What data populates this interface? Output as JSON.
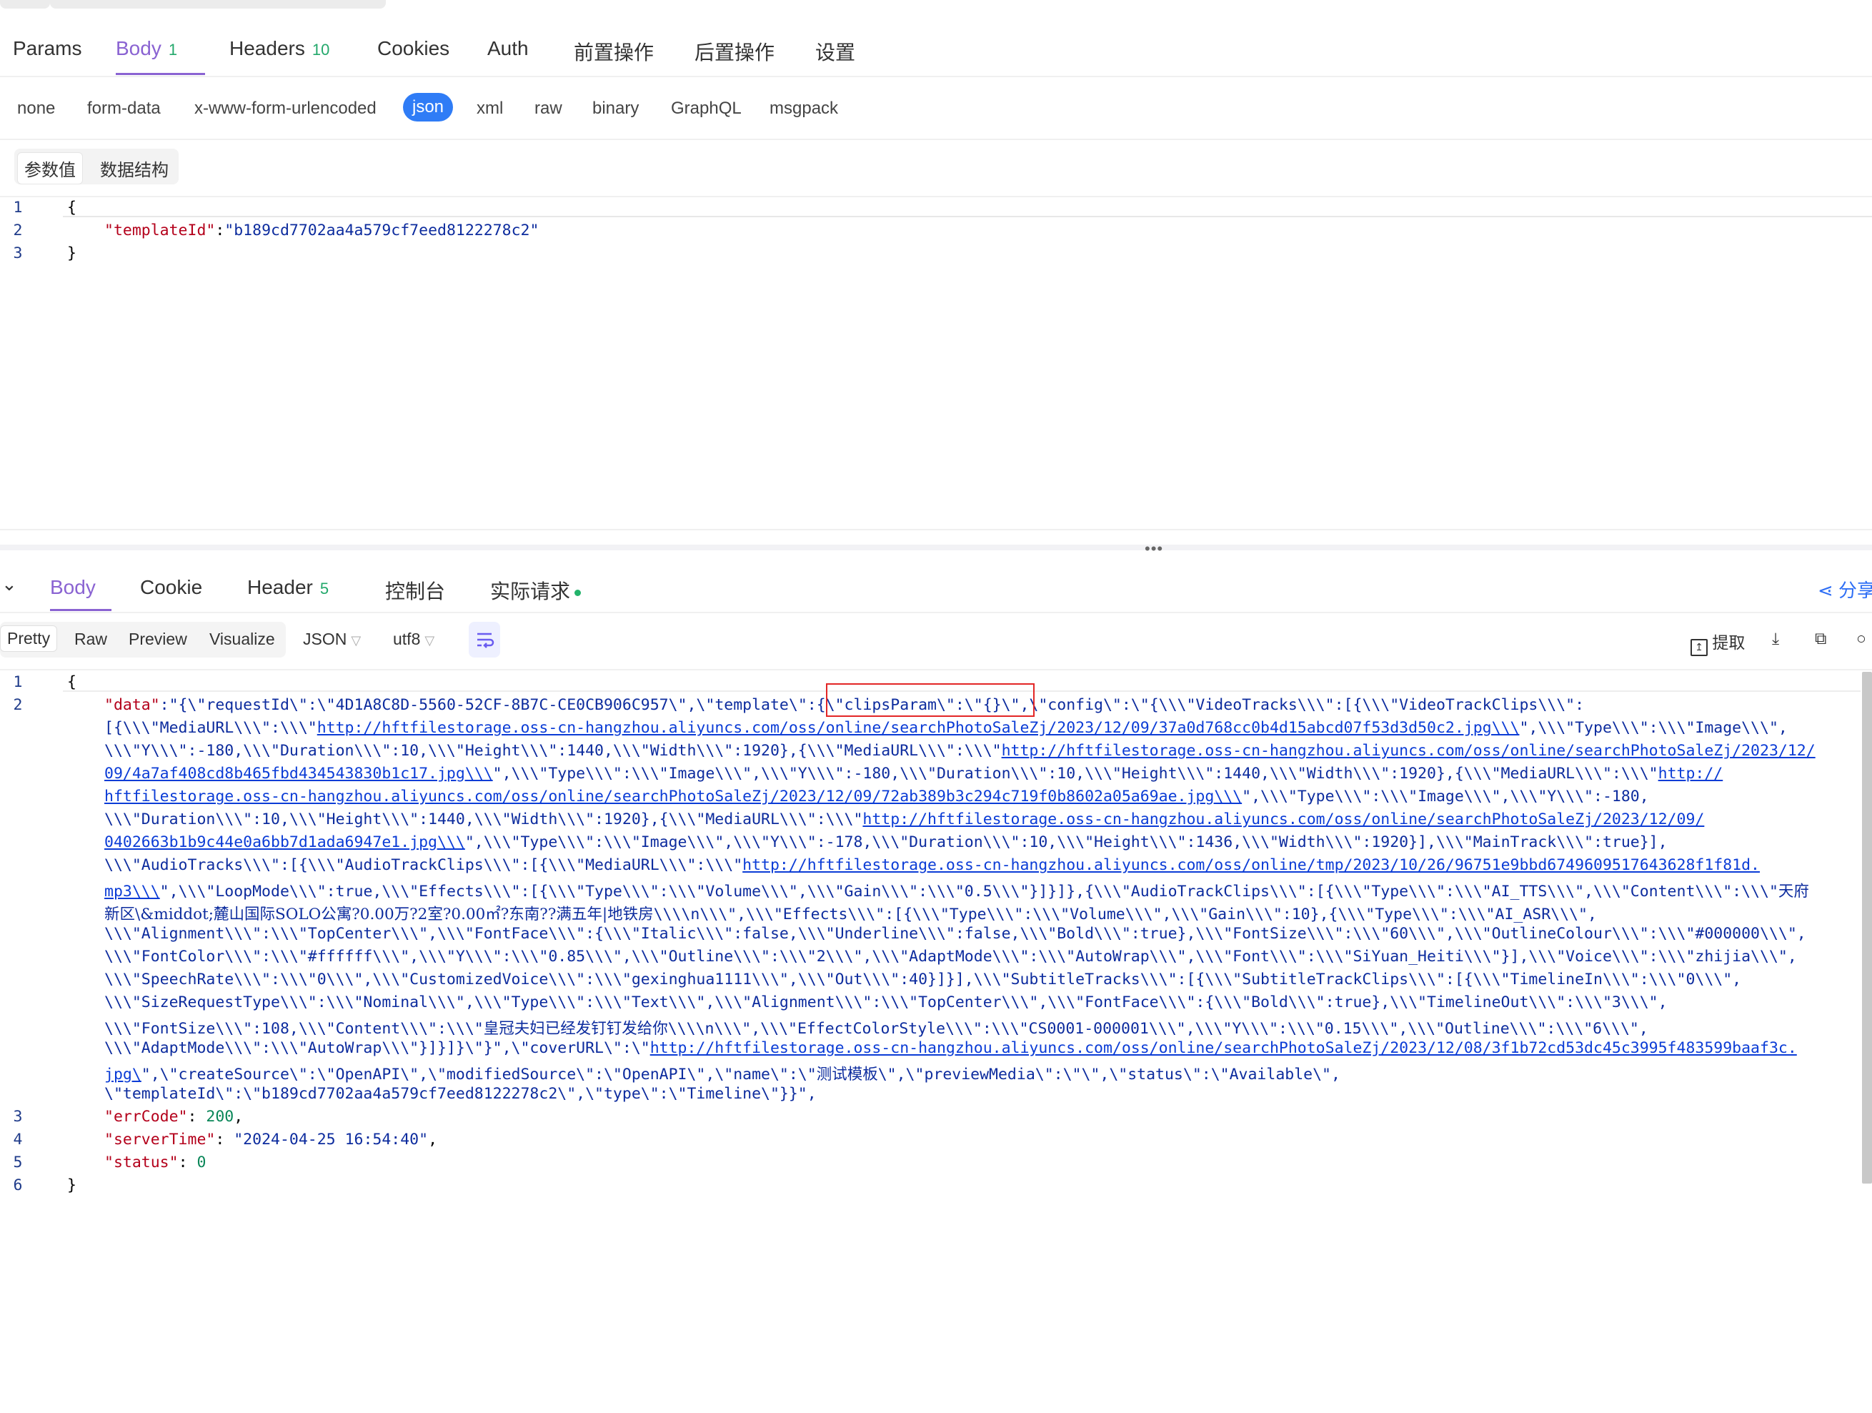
{
  "request": {
    "tabs": [
      {
        "label": "Params",
        "count": ""
      },
      {
        "label": "Body",
        "count": "1"
      },
      {
        "label": "Headers",
        "count": "10"
      },
      {
        "label": "Cookies",
        "count": ""
      },
      {
        "label": "Auth",
        "count": ""
      },
      {
        "label": "前置操作",
        "count": ""
      },
      {
        "label": "后置操作",
        "count": ""
      },
      {
        "label": "设置",
        "count": ""
      }
    ],
    "active_tab": "Body",
    "body_types": [
      "none",
      "form-data",
      "x-www-form-urlencoded",
      "json",
      "xml",
      "raw",
      "binary",
      "GraphQL",
      "msgpack"
    ],
    "active_body_type": "json",
    "segments": [
      "参数值",
      "数据结构"
    ],
    "line_numbers": [
      "1",
      "2",
      "3"
    ],
    "code": {
      "l1": "{",
      "l2_key": "\"templateId\"",
      "l2_colon": ":",
      "l2_val": "\"b189cd7702aa4a579cf7eed8122278c2\"",
      "l3": "}"
    }
  },
  "response": {
    "tabs": [
      {
        "label": "Body",
        "count": ""
      },
      {
        "label": "Cookie",
        "count": ""
      },
      {
        "label": "Header",
        "count": "5"
      },
      {
        "label": "控制台",
        "count": ""
      },
      {
        "label": "实际请求",
        "count": ""
      }
    ],
    "share_label": "分享",
    "view_modes": [
      "Pretty",
      "Raw",
      "Preview",
      "Visualize"
    ],
    "format": "JSON",
    "encoding": "utf8",
    "extract_label": "提取",
    "line_numbers": [
      "1",
      "2",
      "",
      "",
      "",
      "",
      "",
      "",
      "",
      "",
      "",
      "",
      "",
      "",
      "",
      "",
      "",
      "",
      "3",
      "4",
      "5",
      "6"
    ],
    "body": {
      "r1": "{",
      "r2a_key": "\"data\"",
      "r2a_1": ":\"{\\\"requestId\\\":\\\"4D1A8C8D-5560-52CF-8B7C-CE0CB906C957\\\",\\\"template\\\":",
      "r2a_hl": "{\\\"clipsParam\\\":\\\"{}\\",
      "r2a_2": "\",\\\"config\\\":\\\"{\\\\\\\"VideoTracks\\\\\\\":[{\\\\\\\"VideoTrackClips\\\\\\\":",
      "r2b_1": "[{\\\\\\\"MediaURL\\\\\\\":\\\\\\\"",
      "r2b_url": "http://hftfilestorage.oss-cn-hangzhou.aliyuncs.com/oss/online/searchPhotoSaleZj/2023/12/09/37a0d768cc0b4d15abcd07f53d3d50c2.jpg\\\\\\",
      "r2b_2": "\",\\\\\\\"Type\\\\\\\":\\\\\\\"Image\\\\\\\",",
      "r2c_1": "\\\\\\\"Y\\\\\\\":-180,\\\\\\\"Duration\\\\\\\":10,\\\\\\\"Height\\\\\\\":1440,\\\\\\\"Width\\\\\\\":1920},{\\\\\\\"MediaURL\\\\\\\":\\\\\\\"",
      "r2c_url": "http://hftfilestorage.oss-cn-hangzhou.aliyuncs.com/oss/online/searchPhotoSaleZj/2023/12/",
      "r2d_url": "09/4a7af408cd8b465fbd434543830b1c17.jpg\\\\\\",
      "r2d_2": "\",\\\\\\\"Type\\\\\\\":\\\\\\\"Image\\\\\\\",\\\\\\\"Y\\\\\\\":-180,\\\\\\\"Duration\\\\\\\":10,\\\\\\\"Height\\\\\\\":1440,\\\\\\\"Width\\\\\\\":1920},{\\\\\\\"MediaURL\\\\\\\":\\\\\\\"",
      "r2d_url2": "http://",
      "r2e_url": "hftfilestorage.oss-cn-hangzhou.aliyuncs.com/oss/online/searchPhotoSaleZj/2023/12/09/72ab389b3c294c719f0b8602a05a69ae.jpg\\\\\\",
      "r2e_2": "\",\\\\\\\"Type\\\\\\\":\\\\\\\"Image\\\\\\\",\\\\\\\"Y\\\\\\\":-180,",
      "r2f_1": "\\\\\\\"Duration\\\\\\\":10,\\\\\\\"Height\\\\\\\":1440,\\\\\\\"Width\\\\\\\":1920},{\\\\\\\"MediaURL\\\\\\\":\\\\\\\"",
      "r2f_url": "http://hftfilestorage.oss-cn-hangzhou.aliyuncs.com/oss/online/searchPhotoSaleZj/2023/12/09/",
      "r2g_url": "0402663b1b9c44e0a6bb7d1ada6947e1.jpg\\\\\\",
      "r2g_2": "\",\\\\\\\"Type\\\\\\\":\\\\\\\"Image\\\\\\\",\\\\\\\"Y\\\\\\\":-178,\\\\\\\"Duration\\\\\\\":10,\\\\\\\"Height\\\\\\\":1436,\\\\\\\"Width\\\\\\\":1920}],\\\\\\\"MainTrack\\\\\\\":true}],",
      "r2h_1": "\\\\\\\"AudioTracks\\\\\\\":[{\\\\\\\"AudioTrackClips\\\\\\\":[{\\\\\\\"MediaURL\\\\\\\":\\\\\\\"",
      "r2h_url": "http://hftfilestorage.oss-cn-hangzhou.aliyuncs.com/oss/online/tmp/2023/10/26/96751e9bbd6749609517643628f1f81d.",
      "r2i_url": "mp3\\\\\\",
      "r2i_2": "\",\\\\\\\"LoopMode\\\\\\\":true,\\\\\\\"Effects\\\\\\\":[{\\\\\\\"Type\\\\\\\":\\\\\\\"Volume\\\\\\\",\\\\\\\"Gain\\\\\\\":\\\\\\\"0.5\\\\\\\"}]}]},{\\\\\\\"AudioTrackClips\\\\\\\":[{\\\\\\\"Type\\\\\\\":\\\\\\\"AI_TTS\\\\\\\",\\\\\\\"Content\\\\\\\":\\\\\\\"",
      "r2i_cjk": "天府",
      "r2j_cjk": "新区\\&middot;麓山国际SOLO公寓?0.00万?2室?0.00㎡?东南??满五年|地铁房",
      "r2j_2": "\\\\\\\\n\\\\\\\",\\\\\\\"Effects\\\\\\\":[{\\\\\\\"Type\\\\\\\":\\\\\\\"Volume\\\\\\\",\\\\\\\"Gain\\\\\\\":10},{\\\\\\\"Type\\\\\\\":\\\\\\\"AI_ASR\\\\\\\",",
      "r2k": "\\\\\\\"Alignment\\\\\\\":\\\\\\\"TopCenter\\\\\\\",\\\\\\\"FontFace\\\\\\\":{\\\\\\\"Italic\\\\\\\":false,\\\\\\\"Underline\\\\\\\":false,\\\\\\\"Bold\\\\\\\":true},\\\\\\\"FontSize\\\\\\\":\\\\\\\"60\\\\\\\",\\\\\\\"OutlineColour\\\\\\\":\\\\\\\"#000000\\\\\\\",",
      "r2l": "\\\\\\\"FontColor\\\\\\\":\\\\\\\"#ffffff\\\\\\\",\\\\\\\"Y\\\\\\\":\\\\\\\"0.85\\\\\\\",\\\\\\\"Outline\\\\\\\":\\\\\\\"2\\\\\\\",\\\\\\\"AdaptMode\\\\\\\":\\\\\\\"AutoWrap\\\\\\\",\\\\\\\"Font\\\\\\\":\\\\\\\"SiYuan_Heiti\\\\\\\"}],\\\\\\\"Voice\\\\\\\":\\\\\\\"zhijia\\\\\\\",",
      "r2m": "\\\\\\\"SpeechRate\\\\\\\":\\\\\\\"0\\\\\\\",\\\\\\\"CustomizedVoice\\\\\\\":\\\\\\\"gexinghua1111\\\\\\\",\\\\\\\"Out\\\\\\\":40}]}],\\\\\\\"SubtitleTracks\\\\\\\":[{\\\\\\\"SubtitleTrackClips\\\\\\\":[{\\\\\\\"TimelineIn\\\\\\\":\\\\\\\"0\\\\\\\",",
      "r2n": "\\\\\\\"SizeRequestType\\\\\\\":\\\\\\\"Nominal\\\\\\\",\\\\\\\"Type\\\\\\\":\\\\\\\"Text\\\\\\\",\\\\\\\"Alignment\\\\\\\":\\\\\\\"TopCenter\\\\\\\",\\\\\\\"FontFace\\\\\\\":{\\\\\\\"Bold\\\\\\\":true},\\\\\\\"TimelineOut\\\\\\\":\\\\\\\"3\\\\\\\",",
      "r2o_1": "\\\\\\\"FontSize\\\\\\\":108,\\\\\\\"Content\\\\\\\":\\\\\\\"",
      "r2o_cjk": "皇冠夫妇已经发钉钉发给你",
      "r2o_2": "\\\\\\\\n\\\\\\\",\\\\\\\"EffectColorStyle\\\\\\\":\\\\\\\"CS0001-000001\\\\\\\",\\\\\\\"Y\\\\\\\":\\\\\\\"0.15\\\\\\\",\\\\\\\"Outline\\\\\\\":\\\\\\\"6\\\\\\\",",
      "r2p_1": "\\\\\\\"AdaptMode\\\\\\\":\\\\\\\"AutoWrap\\\\\\\"}]}]}\\\"}\",\\\"coverURL\\\":\\\"",
      "r2p_url": "http://hftfilestorage.oss-cn-hangzhou.aliyuncs.com/oss/online/searchPhotoSaleZj/2023/12/08/3f1b72cd53dc45c3995f483599baaf3c.",
      "r2q_url": "jpg\\",
      "r2q_1": "\",\\\"createSource\\\":\\\"OpenAPI\\\",\\\"modifiedSource\\\":\\\"OpenAPI\\\",\\\"name\\\":\\\"",
      "r2q_cjk": "测试模板",
      "r2q_2": "\\\",\\\"previewMedia\\\":\\\"\\\",\\\"status\\\":\\\"Available\\\",",
      "r2r": "\\\"templateId\\\":\\\"b189cd7702aa4a579cf7eed8122278c2\\\",\\\"type\\\":\\\"Timeline\\\"}}\",",
      "r3_key": "\"errCode\"",
      "r3_val": "200",
      "r4_key": "\"serverTime\"",
      "r4_val": "\"2024-04-25 16:54:40\"",
      "r5_key": "\"status\"",
      "r5_val": "0",
      "r6": "}"
    }
  },
  "colors": {
    "accent": "#8a63d2",
    "json_pill": "#2f7cf6",
    "count_green": "#23a86b",
    "highlight_red": "#e32626"
  }
}
